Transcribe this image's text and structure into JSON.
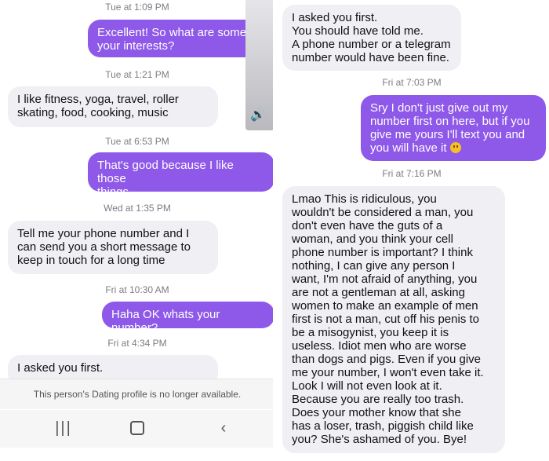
{
  "left": {
    "timestamps": [
      "Tue at 1:09 PM",
      "Tue at 1:21 PM",
      "Tue at 6:53 PM",
      "Wed at 1:35 PM",
      "Fri at 10:30 AM",
      "Fri at 4:34 PM"
    ],
    "messages": [
      {
        "text": "Excellent! So what are some\nyour interests?"
      },
      {
        "text": "I like fitness, yoga, travel, roller\nskating, food, cooking, music"
      },
      {
        "text": "That's good because I like those\nthings."
      },
      {
        "text": "Tell me your phone number and I\ncan send you a short message to\nkeep in touch for a long time"
      },
      {
        "text": "Haha OK whats your number?"
      },
      {
        "text": "I asked you first."
      }
    ],
    "notice": "This person's Dating profile is no longer available.",
    "navbar": {
      "recent": "|||",
      "back": "‹"
    }
  },
  "right": {
    "timestamps": [
      "Fri at 7:03 PM",
      "Fri at 7:16 PM"
    ],
    "messages": [
      {
        "text": "I asked you first.\nYou should have told me.\nA phone number or a telegram\nnumber would have been fine."
      },
      {
        "text": "Sry I don't just give out my\nnumber first on here, but if you\ngive me yours I'll text you and\nyou will have it "
      },
      {
        "text": "Lmao This is ridiculous, you\nwouldn't be considered a man, you\ndon't even have the guts of a\nwoman, and you think your cell\nphone number is important? I think\nnothing, I can give any person I\nwant, I'm not afraid of anything, you\nare not a gentleman at all, asking\nwomen to make an example of men\nfirst is not a man, cut off his penis to\nbe a misogynist, you keep it is\nuseless. Idiot men who are worse\nthan dogs and pigs. Even if you give\nme your number, I won't even take it.\nLook I will not even look at it.\nBecause you are really too trash.\nDoes your mother know that she\nhas a loser, trash, piggish child like\nyou? She's ashamed of you. Bye!"
      }
    ]
  },
  "colors": {
    "outgoing": "#8e58e8",
    "incoming": "#efeff4"
  },
  "icons": {
    "emoji": "smiling-face-emoji",
    "volume": "speaker-icon"
  }
}
